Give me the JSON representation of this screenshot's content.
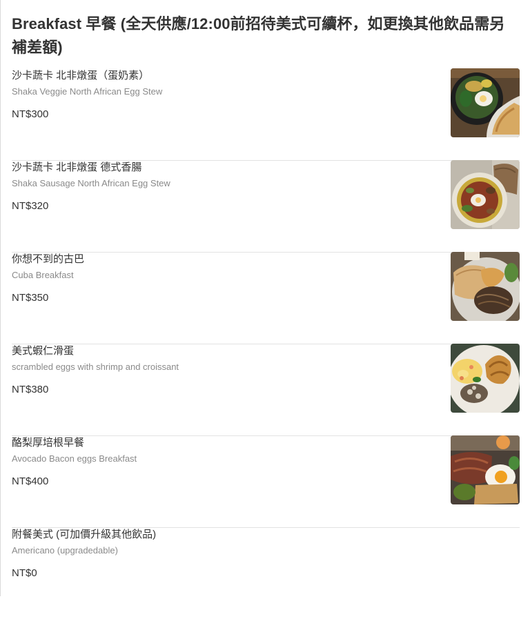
{
  "section": {
    "title": "Breakfast 早餐 (全天供應/12:00前招待美式可續杯，如更換其他飲品需另補差額)"
  },
  "items": [
    {
      "name": "沙卡蔬卡 北非燉蛋（蛋奶素）",
      "description": "Shaka Veggie North African Egg Stew",
      "price": "NT$300",
      "image": "veggie-egg-stew-photo"
    },
    {
      "name": "沙卡蔬卡 北非燉蛋 德式香腸",
      "description": "Shaka Sausage North African Egg Stew",
      "price": "NT$320",
      "image": "sausage-egg-stew-photo"
    },
    {
      "name": "你想不到的古巴",
      "description": "Cuba Breakfast",
      "price": "NT$350",
      "image": "cuba-breakfast-photo"
    },
    {
      "name": "美式蝦仁滑蛋",
      "description": "scrambled eggs with shrimp and croissant",
      "price": "NT$380",
      "image": "shrimp-eggs-croissant-photo"
    },
    {
      "name": "酪梨厚培根早餐",
      "description": "Avocado Bacon eggs Breakfast",
      "price": "NT$400",
      "image": "avocado-bacon-eggs-photo"
    },
    {
      "name": "附餐美式 (可加價升級其他飲品)",
      "description": "Americano (upgradedable)",
      "price": "NT$0"
    }
  ]
}
